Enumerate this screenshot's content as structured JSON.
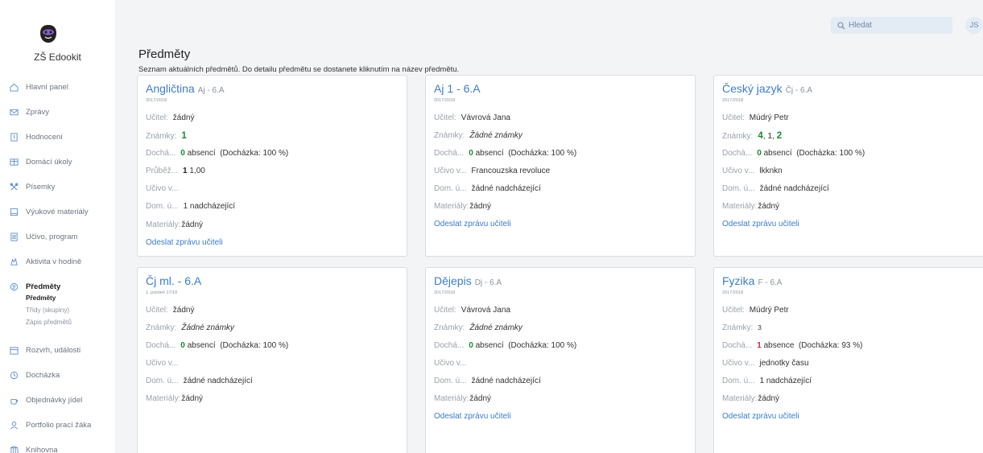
{
  "app": {
    "school_name": "ZŠ Edookit"
  },
  "sidebar": {
    "items": [
      {
        "label": "Hlavní panel"
      },
      {
        "label": "Zprávy"
      },
      {
        "label": "Hodnocení"
      },
      {
        "label": "Domácí úkoly"
      },
      {
        "label": "Písemky"
      },
      {
        "label": "Výukové materiály"
      },
      {
        "label": "Učivo, program"
      },
      {
        "label": "Aktivita v hodině"
      },
      {
        "label": "Předměty"
      },
      {
        "label": "Rozvrh, události"
      },
      {
        "label": "Docházka"
      },
      {
        "label": "Objednávky jídel"
      },
      {
        "label": "Portfolio prací žáka"
      },
      {
        "label": "Knihovna"
      }
    ],
    "subitems": [
      "Předměty",
      "Třídy (skupiny)",
      "Zápis předmětů"
    ]
  },
  "search": {
    "placeholder": "Hledat"
  },
  "user": {
    "initials": "JS"
  },
  "page": {
    "title": "Předměty",
    "subtitle": "Seznam aktuálních předmětů. Do detailu předmětu se dostanete kliknutím na název předmětu."
  },
  "labels": {
    "teacher": "Učitel:",
    "grades": "Známky:",
    "attendance": "Dochá...",
    "progress": "Průběž...",
    "curriculum": "Učivo v...",
    "homework": "Dom. ú...",
    "materials": "Materiály:",
    "send_message": "Odeslat zprávu učiteli"
  },
  "cards": [
    {
      "title": "Angličtina",
      "class": "Aj - 6.A",
      "year": "2017/2018",
      "teacher": "žádný",
      "grades": "1",
      "absence_count": "0",
      "absence_text": "absencí",
      "attendance_pct": "(Docházka: 100 %)",
      "progress_val": "1",
      "progress_rest": "1,00",
      "curriculum": "",
      "homework": "1 nadcházející",
      "materials": "žádný"
    },
    {
      "title": "Aj 1 - 6.A",
      "class": "",
      "year": "2017/2018",
      "teacher": "Vávrová Jana",
      "grades": "Žádné známky",
      "absence_count": "0",
      "absence_text": "absencí",
      "attendance_pct": "(Docházka: 100 %)",
      "curriculum": "Francouzska revoluce",
      "homework": "žádné nadcházející",
      "materials": "žádný"
    },
    {
      "title": "Český jazyk",
      "class": "Čj - 6.A",
      "year": "2017/2018",
      "teacher": "Múdrý Petr",
      "grades": [
        "4",
        "1",
        "2"
      ],
      "absence_count": "0",
      "absence_text": "absencí",
      "attendance_pct": "(Docházka: 100 %)",
      "curriculum": "lkknkn",
      "homework": "žádné nadcházející",
      "materials": "žádný"
    },
    {
      "title": "Čj ml. - 6.A",
      "class": "",
      "year": "1. pololetí 17/18",
      "teacher": "žádný",
      "grades": "Žádné známky",
      "absence_count": "0",
      "absence_text": "absencí",
      "attendance_pct": "(Docházka: 100 %)",
      "curriculum": "",
      "homework": "žádné nadcházející",
      "materials": "žádný"
    },
    {
      "title": "Dějepis",
      "class": "Dj - 6.A",
      "year": "2017/2018",
      "teacher": "Vávrová Jana",
      "grades": "Žádné známky",
      "absence_count": "0",
      "absence_text": "absencí",
      "attendance_pct": "(Docházka: 100 %)",
      "curriculum": "",
      "homework": "žádné nadcházející",
      "materials": "žádný"
    },
    {
      "title": "Fyzika",
      "class": "F - 6.A",
      "year": "2017/2018",
      "teacher": "Múdrý Petr",
      "grades": "3",
      "absence_count": "1",
      "absence_text": "absence",
      "attendance_pct": "(Docházka: 93 %)",
      "curriculum": "jednotky času",
      "homework": "1 nadcházející",
      "materials": "žádný"
    }
  ],
  "colors": {
    "accent": "#3d7ccb",
    "green": "#1a8b2e",
    "red": "#d62d2d",
    "background": "#f3f4f6"
  }
}
